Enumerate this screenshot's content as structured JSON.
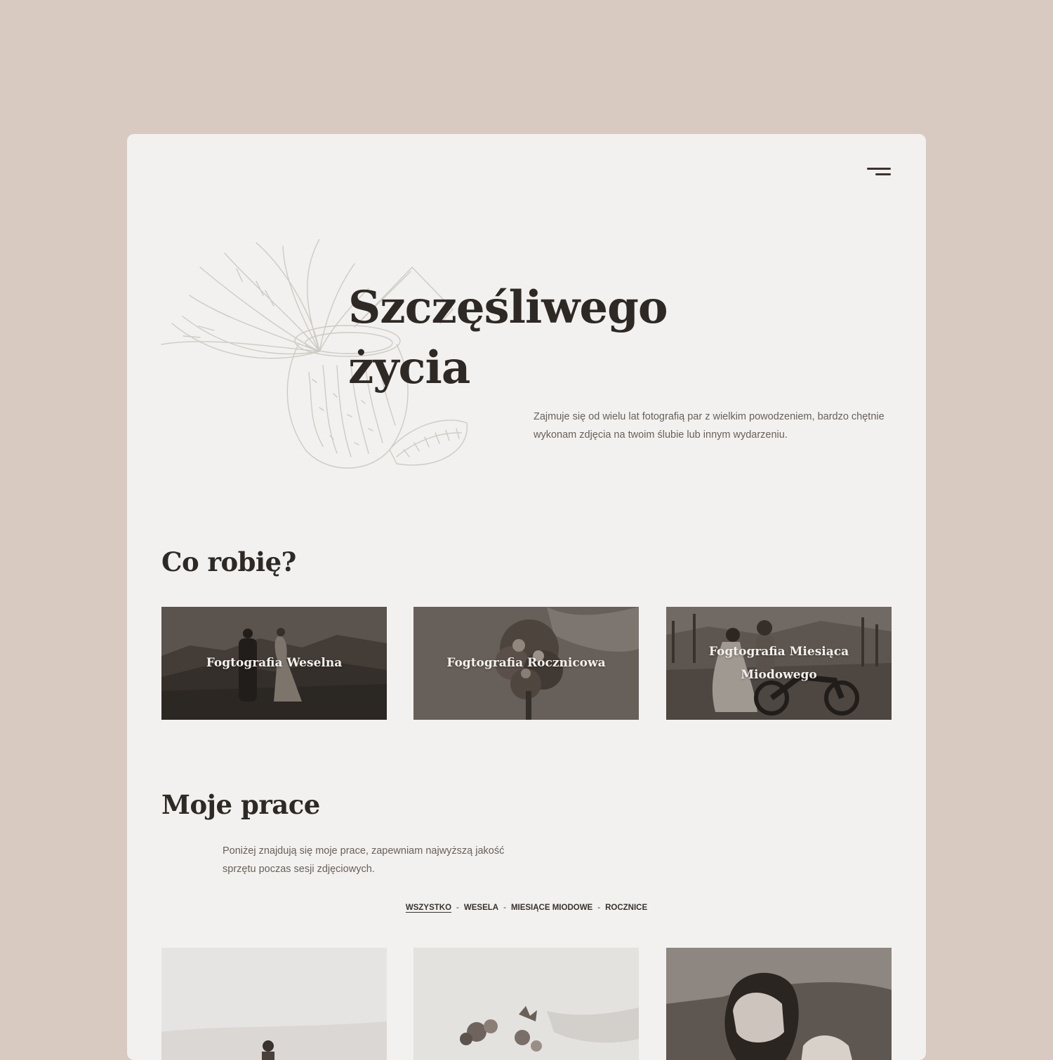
{
  "hero": {
    "title_line1": "Szczęśliwego",
    "title_line2": "życia",
    "description": "Zajmuje się od wielu lat fotografią par z wielkim powodzeniem, bardzo chętnie wykonam zdjęcia na twoim ślubie lub innym wydarzeniu."
  },
  "services": {
    "title": "Co robię?",
    "items": [
      {
        "label": "Fogtografia Weselna"
      },
      {
        "label": "Fogtografia Rocznicowa"
      },
      {
        "label": "Fogtografia Miesiąca Miodowego"
      }
    ]
  },
  "works": {
    "title": "Moje prace",
    "description": "Poniżej znajdują się moje prace, zapewniam najwyższą jakość sprzętu poczas sesji zdjęciowych.",
    "filters": [
      "WSZYSTKO",
      "WESELA",
      "MIESIĄCE MIODOWE",
      "ROCZNICE"
    ],
    "active_filter": "WSZYSTKO",
    "separator": "-"
  },
  "colors": {
    "page_bg": "#d8cac1",
    "card_bg": "#f2f1ef",
    "text_dark": "#2f2925",
    "text_muted": "#6a5f58"
  },
  "icons": {
    "menu": "hamburger-menu-icon",
    "illustration": "coconut-palm-illustration"
  }
}
